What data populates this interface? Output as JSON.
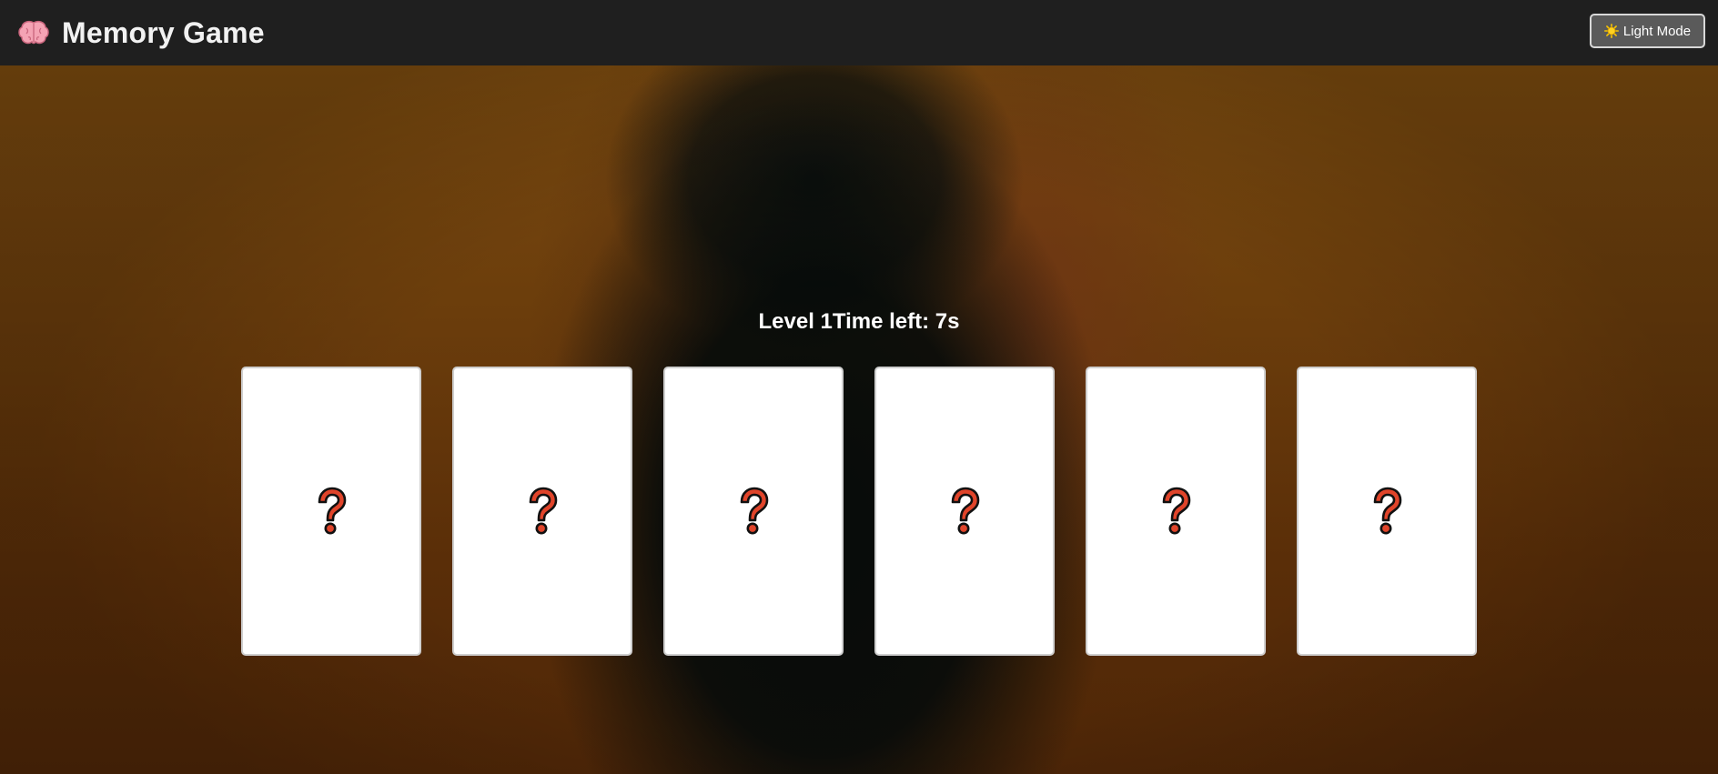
{
  "header": {
    "title": "Memory Game",
    "logo_icon": "brain-icon",
    "theme_button": {
      "label": "Light Mode",
      "icon": "sun-icon"
    }
  },
  "game": {
    "level_text": "Level 1",
    "time_text": "Time left: 7s",
    "cards": [
      {
        "face": "question-mark-icon"
      },
      {
        "face": "question-mark-icon"
      },
      {
        "face": "question-mark-icon"
      },
      {
        "face": "question-mark-icon"
      },
      {
        "face": "question-mark-icon"
      },
      {
        "face": "question-mark-icon"
      }
    ]
  },
  "colors": {
    "header_bg": "#1f1f1f",
    "card_bg": "#ffffff",
    "question_mark": "#e0442a"
  }
}
